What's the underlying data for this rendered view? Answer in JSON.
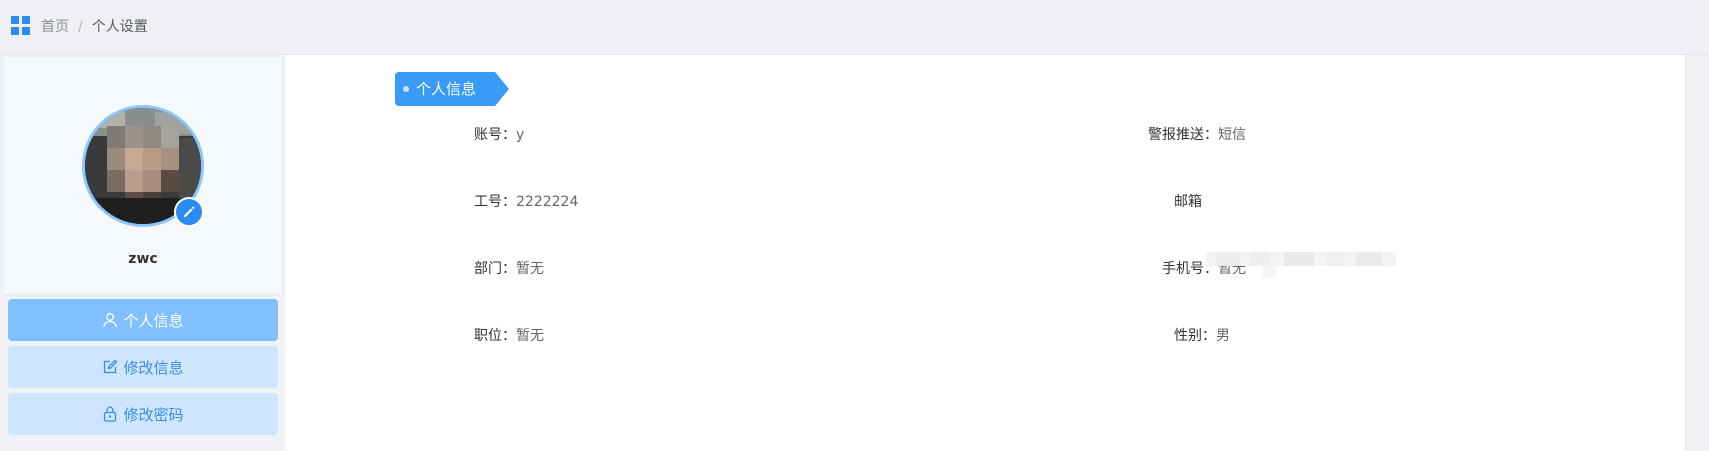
{
  "breadcrumb": {
    "home": "首页",
    "separator": "/",
    "current": "个人设置"
  },
  "profile": {
    "username": "zwc"
  },
  "menu": {
    "items": [
      {
        "label": "个人信息",
        "icon": "user-icon",
        "active": true
      },
      {
        "label": "修改信息",
        "icon": "edit-icon",
        "active": false
      },
      {
        "label": "修改密码",
        "icon": "lock-icon",
        "active": false
      }
    ]
  },
  "section": {
    "title": "个人信息"
  },
  "fields": {
    "account": {
      "label": "账号：",
      "value": "y"
    },
    "employee_id": {
      "label": "工号：",
      "value": "2222224"
    },
    "department": {
      "label": "部门：",
      "value": "暂无"
    },
    "position": {
      "label": "职位：",
      "value": "暂无"
    },
    "alert_push": {
      "label": "警报推送：",
      "value": "短信"
    },
    "email": {
      "label": "邮箱",
      "value": ""
    },
    "phone": {
      "label": "手机号：",
      "value": "暂无"
    },
    "gender": {
      "label": "性别：",
      "value": "男"
    }
  },
  "colors": {
    "accent": "#2b8bf2",
    "menu_active": "#82c0fd",
    "menu_normal": "#cde6fd",
    "tag": "#3a9bf7"
  }
}
